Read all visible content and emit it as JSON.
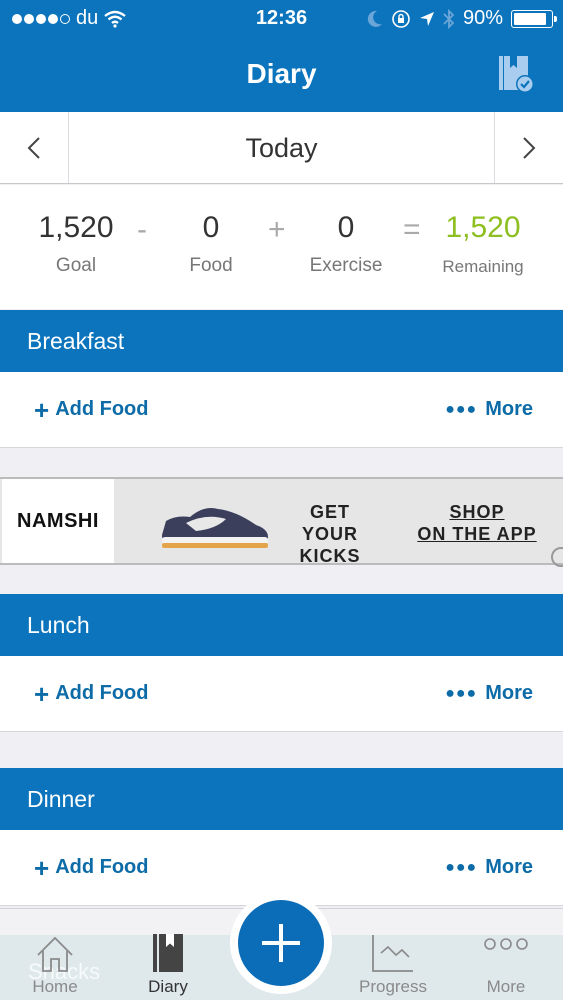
{
  "status_bar": {
    "signal_bars_filled": 4,
    "signal_bars_total": 5,
    "carrier": "du",
    "time": "12:36",
    "battery_percent_label": "90%",
    "battery_level": 0.9,
    "icons": [
      "wifi-icon",
      "moon-icon",
      "rotation-lock-icon",
      "location-icon",
      "bluetooth-icon",
      "battery-icon"
    ]
  },
  "nav": {
    "title": "Diary",
    "right_icon": "diary-complete-icon"
  },
  "date_nav": {
    "prev_icon": "chevron-left-icon",
    "label": "Today",
    "next_icon": "chevron-right-icon"
  },
  "summary": {
    "goal_value": "1,520",
    "goal_label": "Goal",
    "op_minus": "-",
    "food_value": "0",
    "food_label": "Food",
    "op_plus": "+",
    "exercise_value": "0",
    "exercise_label": "Exercise",
    "op_equals": "=",
    "remaining_value": "1,520",
    "remaining_label": "Remaining",
    "remaining_color": "#8cbf1f"
  },
  "meals": [
    {
      "title": "Breakfast",
      "add_label": "Add Food",
      "more_label": "More"
    },
    {
      "title": "Lunch",
      "add_label": "Add Food",
      "more_label": "More"
    },
    {
      "title": "Dinner",
      "add_label": "Add Food",
      "more_label": "More"
    }
  ],
  "ad": {
    "brand": "NAMSHI",
    "tagline_1": "GET YOUR",
    "tagline_2": "KICKS",
    "cta_1": "SHOP",
    "cta_2": "ON THE APP"
  },
  "tabbar": {
    "ghost_section": "Snacks",
    "tabs": [
      {
        "label": "Home",
        "icon": "home-icon",
        "active": false
      },
      {
        "label": "Diary",
        "icon": "diary-icon",
        "active": true
      },
      {
        "label": "Progress",
        "icon": "progress-chart-icon",
        "active": false
      },
      {
        "label": "More",
        "icon": "more-dots-icon",
        "active": false
      }
    ],
    "fab_icon": "plus-icon"
  },
  "colors": {
    "brand_blue": "#0b74bd",
    "link_blue": "#0d6ca8",
    "remaining_green": "#8cbf1f"
  }
}
